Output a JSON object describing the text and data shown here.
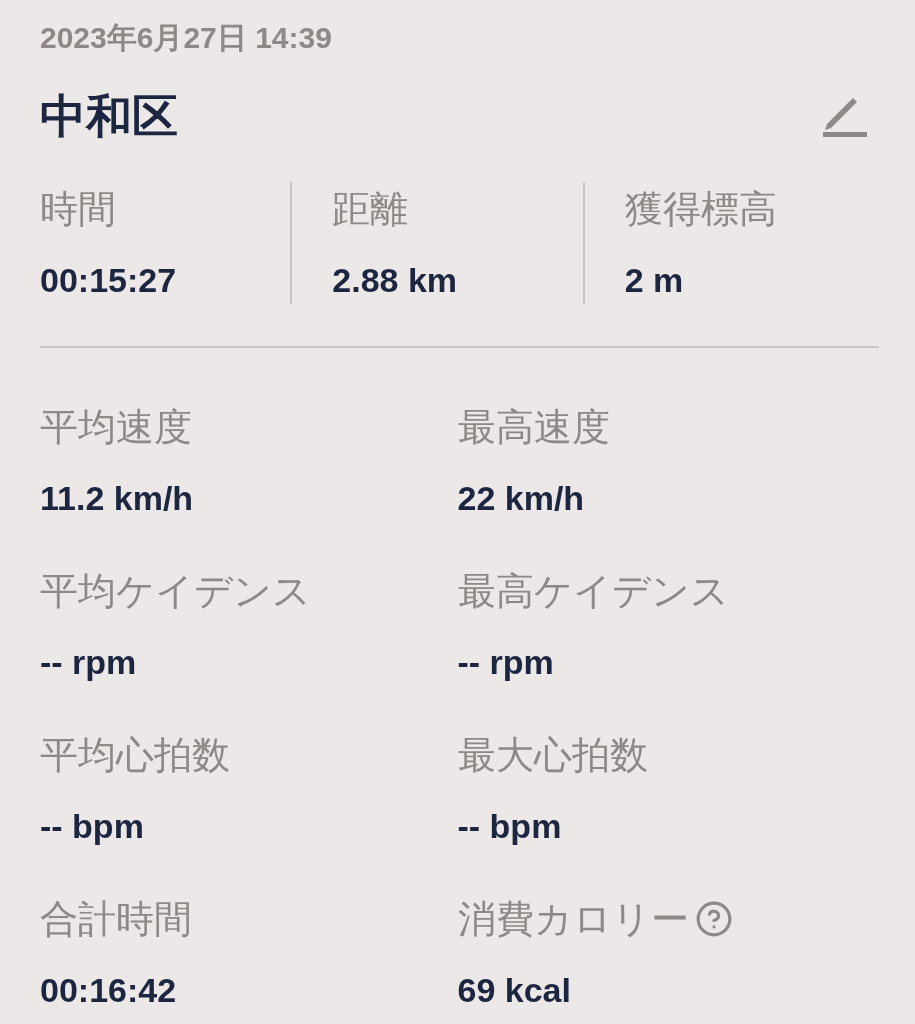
{
  "date": "2023年6月27日 14:39",
  "title": "中和区",
  "summary": [
    {
      "label": "時間",
      "value": "00:15:27"
    },
    {
      "label": "距離",
      "value": "2.88 km"
    },
    {
      "label": "獲得標高",
      "value": "2 m"
    }
  ],
  "stats": [
    {
      "label": "平均速度",
      "value": "11.2 km/h",
      "help": false
    },
    {
      "label": "最高速度",
      "value": "22 km/h",
      "help": false
    },
    {
      "label": "平均ケイデンス",
      "value": "-- rpm",
      "help": false
    },
    {
      "label": "最高ケイデンス",
      "value": "-- rpm",
      "help": false
    },
    {
      "label": "平均心拍数",
      "value": "-- bpm",
      "help": false
    },
    {
      "label": "最大心拍数",
      "value": "-- bpm",
      "help": false
    },
    {
      "label": "合計時間",
      "value": "00:16:42",
      "help": false
    },
    {
      "label": "消費カロリー",
      "value": "69 kcal",
      "help": true
    }
  ]
}
